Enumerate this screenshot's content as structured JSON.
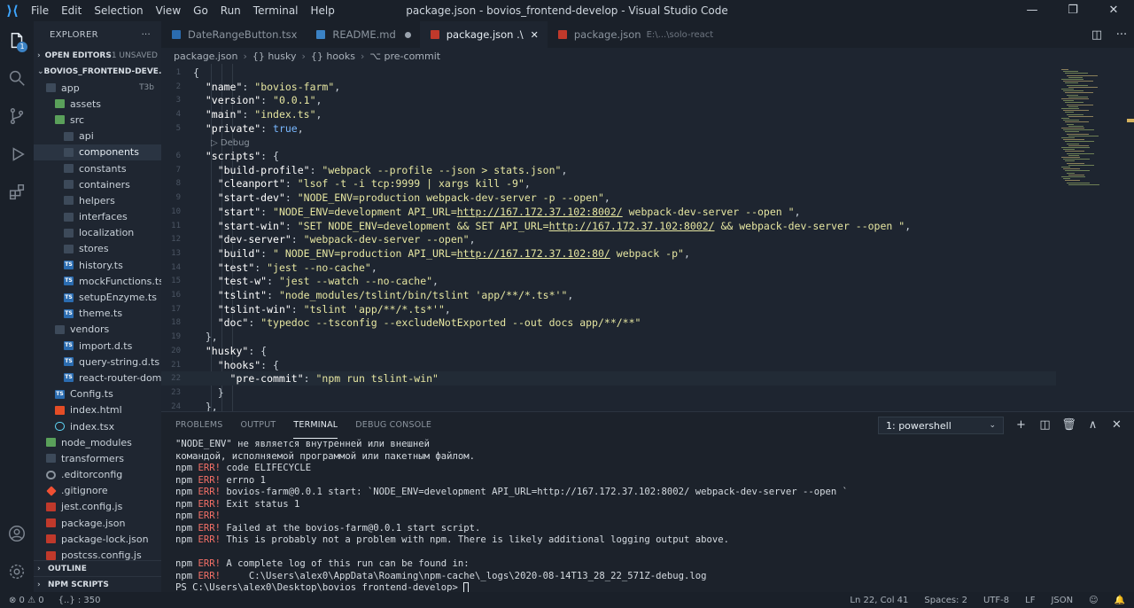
{
  "titlebar": {
    "menu": [
      "File",
      "Edit",
      "Selection",
      "View",
      "Go",
      "Run",
      "Terminal",
      "Help"
    ],
    "title": "package.json - bovios_frontend-develop - Visual Studio Code",
    "minimize": "—",
    "maximize": "❐",
    "close": "✕"
  },
  "activity": {
    "badge": "1"
  },
  "sidebar": {
    "title": "EXPLORER",
    "more": "···",
    "open_editors": "OPEN EDITORS",
    "unsaved": "1 UNSAVED",
    "project": "BOVIOS_FRONTEND-DEVE...",
    "tree": [
      {
        "label": "app",
        "icon": "folder",
        "depth": 0,
        "tag": "T3b"
      },
      {
        "label": "assets",
        "icon": "green",
        "depth": 1
      },
      {
        "label": "src",
        "icon": "green",
        "depth": 1
      },
      {
        "label": "api",
        "icon": "folder",
        "depth": 2
      },
      {
        "label": "components",
        "icon": "folder",
        "depth": 2,
        "selected": true
      },
      {
        "label": "constants",
        "icon": "folder",
        "depth": 2
      },
      {
        "label": "containers",
        "icon": "folder",
        "depth": 2
      },
      {
        "label": "helpers",
        "icon": "folder",
        "depth": 2
      },
      {
        "label": "interfaces",
        "icon": "folder",
        "depth": 2
      },
      {
        "label": "localization",
        "icon": "folder",
        "depth": 2
      },
      {
        "label": "stores",
        "icon": "folder",
        "depth": 2
      },
      {
        "label": "history.ts",
        "icon": "ts",
        "depth": 2
      },
      {
        "label": "mockFunctions.ts",
        "icon": "ts",
        "depth": 2
      },
      {
        "label": "setupEnzyme.ts",
        "icon": "ts",
        "depth": 2
      },
      {
        "label": "theme.ts",
        "icon": "ts",
        "depth": 2
      },
      {
        "label": "vendors",
        "icon": "folder",
        "depth": 1
      },
      {
        "label": "import.d.ts",
        "icon": "ts",
        "depth": 2
      },
      {
        "label": "query-string.d.ts",
        "icon": "ts",
        "depth": 2
      },
      {
        "label": "react-router-dom...",
        "icon": "ts",
        "depth": 2
      },
      {
        "label": "Config.ts",
        "icon": "ts",
        "depth": 1
      },
      {
        "label": "index.html",
        "icon": "html",
        "depth": 1
      },
      {
        "label": "index.tsx",
        "icon": "react",
        "depth": 1
      },
      {
        "label": "node_modules",
        "icon": "green",
        "depth": 0
      },
      {
        "label": "transformers",
        "icon": "folder",
        "depth": 0
      },
      {
        "label": ".editorconfig",
        "icon": "gear",
        "depth": 0
      },
      {
        "label": ".gitignore",
        "icon": "git",
        "depth": 0
      },
      {
        "label": "jest.config.js",
        "icon": "json",
        "depth": 0
      },
      {
        "label": "package.json",
        "icon": "json",
        "depth": 0
      },
      {
        "label": "package-lock.json",
        "icon": "json",
        "depth": 0
      },
      {
        "label": "postcss.config.js",
        "icon": "json",
        "depth": 0
      }
    ],
    "outline": "OUTLINE",
    "npm_scripts": "NPM SCRIPTS"
  },
  "tabs": [
    {
      "label": "DateRangeButton.tsx",
      "icon_color": "#2b6cb0",
      "active": false
    },
    {
      "label": "README.md",
      "icon_color": "#3b82c4",
      "active": false,
      "dirty": true
    },
    {
      "label": "package.json .\\",
      "icon_color": "#c0392b",
      "active": true
    },
    {
      "label": "package.json",
      "icon_color": "#c0392b",
      "active": false,
      "hint": "E:\\...\\solo-react"
    }
  ],
  "tab_actions": {
    "split": "◫",
    "more": "···"
  },
  "breadcrumb": [
    "package.json",
    "{} husky",
    "{} hooks",
    "⌥ pre-commit"
  ],
  "editor": {
    "debug_lens": "▷ Debug",
    "lines": [
      {
        "n": "1",
        "parts": [
          [
            "p",
            "{"
          ]
        ]
      },
      {
        "n": "2",
        "parts": [
          [
            "p",
            "  "
          ],
          [
            "k",
            "\"name\""
          ],
          [
            "p",
            ": "
          ],
          [
            "s",
            "\"bovios-farm\""
          ],
          [
            "p",
            ","
          ]
        ]
      },
      {
        "n": "3",
        "parts": [
          [
            "p",
            "  "
          ],
          [
            "k",
            "\"version\""
          ],
          [
            "p",
            ": "
          ],
          [
            "s",
            "\"0.0.1\""
          ],
          [
            "p",
            ","
          ]
        ]
      },
      {
        "n": "4",
        "parts": [
          [
            "p",
            "  "
          ],
          [
            "k",
            "\"main\""
          ],
          [
            "p",
            ": "
          ],
          [
            "s",
            "\"index.ts\""
          ],
          [
            "p",
            ","
          ]
        ]
      },
      {
        "n": "5",
        "parts": [
          [
            "p",
            "  "
          ],
          [
            "k",
            "\"private\""
          ],
          [
            "p",
            ": "
          ],
          [
            "b",
            "true"
          ],
          [
            "p",
            ","
          ]
        ]
      },
      {
        "n": "",
        "lens": true
      },
      {
        "n": "6",
        "parts": [
          [
            "p",
            "  "
          ],
          [
            "k",
            "\"scripts\""
          ],
          [
            "p",
            ": {"
          ]
        ]
      },
      {
        "n": "7",
        "parts": [
          [
            "p",
            "    "
          ],
          [
            "k",
            "\"build-profile\""
          ],
          [
            "p",
            ": "
          ],
          [
            "s",
            "\"webpack --profile --json > stats.json\""
          ],
          [
            "p",
            ","
          ]
        ]
      },
      {
        "n": "8",
        "parts": [
          [
            "p",
            "    "
          ],
          [
            "k",
            "\"cleanport\""
          ],
          [
            "p",
            ": "
          ],
          [
            "s",
            "\"lsof -t -i tcp:9999 | xargs kill -9\""
          ],
          [
            "p",
            ","
          ]
        ]
      },
      {
        "n": "9",
        "parts": [
          [
            "p",
            "    "
          ],
          [
            "k",
            "\"start-dev\""
          ],
          [
            "p",
            ": "
          ],
          [
            "s",
            "\"NODE_ENV=production webpack-dev-server -p --open\""
          ],
          [
            "p",
            ","
          ]
        ]
      },
      {
        "n": "10",
        "parts": [
          [
            "p",
            "    "
          ],
          [
            "k",
            "\"start\""
          ],
          [
            "p",
            ": "
          ],
          [
            "s",
            "\"NODE_ENV=development API_URL="
          ],
          [
            "su",
            "http://167.172.37.102:8002/"
          ],
          [
            "s",
            " webpack-dev-server --open \""
          ],
          [
            "p",
            ","
          ]
        ]
      },
      {
        "n": "11",
        "parts": [
          [
            "p",
            "    "
          ],
          [
            "k",
            "\"start-win\""
          ],
          [
            "p",
            ": "
          ],
          [
            "s",
            "\"SET NODE_ENV=development && SET API_URL="
          ],
          [
            "su",
            "http://167.172.37.102:8002/"
          ],
          [
            "s",
            " && webpack-dev-server --open \""
          ],
          [
            "p",
            ","
          ]
        ]
      },
      {
        "n": "12",
        "parts": [
          [
            "p",
            "    "
          ],
          [
            "k",
            "\"dev-server\""
          ],
          [
            "p",
            ": "
          ],
          [
            "s",
            "\"webpack-dev-server --open\""
          ],
          [
            "p",
            ","
          ]
        ]
      },
      {
        "n": "13",
        "parts": [
          [
            "p",
            "    "
          ],
          [
            "k",
            "\"build\""
          ],
          [
            "p",
            ": "
          ],
          [
            "s",
            "\" NODE_ENV=production API_URL="
          ],
          [
            "su",
            "http://167.172.37.102:80/"
          ],
          [
            "s",
            " webpack -p\""
          ],
          [
            "p",
            ","
          ]
        ]
      },
      {
        "n": "14",
        "parts": [
          [
            "p",
            "    "
          ],
          [
            "k",
            "\"test\""
          ],
          [
            "p",
            ": "
          ],
          [
            "s",
            "\"jest --no-cache\""
          ],
          [
            "p",
            ","
          ]
        ]
      },
      {
        "n": "15",
        "parts": [
          [
            "p",
            "    "
          ],
          [
            "k",
            "\"test-w\""
          ],
          [
            "p",
            ": "
          ],
          [
            "s",
            "\"jest --watch --no-cache\""
          ],
          [
            "p",
            ","
          ]
        ]
      },
      {
        "n": "16",
        "parts": [
          [
            "p",
            "    "
          ],
          [
            "k",
            "\"tslint\""
          ],
          [
            "p",
            ": "
          ],
          [
            "s",
            "\"node_modules/tslint/bin/tslint 'app/**/*.ts*'\""
          ],
          [
            "p",
            ","
          ]
        ]
      },
      {
        "n": "17",
        "parts": [
          [
            "p",
            "    "
          ],
          [
            "k",
            "\"tslint-win\""
          ],
          [
            "p",
            ": "
          ],
          [
            "s",
            "\"tslint 'app/**/*.ts*'\""
          ],
          [
            "p",
            ","
          ]
        ]
      },
      {
        "n": "18",
        "parts": [
          [
            "p",
            "    "
          ],
          [
            "k",
            "\"doc\""
          ],
          [
            "p",
            ": "
          ],
          [
            "s",
            "\"typedoc --tsconfig --excludeNotExported --out docs app/**/**\""
          ]
        ]
      },
      {
        "n": "19",
        "parts": [
          [
            "p",
            "  },"
          ]
        ]
      },
      {
        "n": "20",
        "parts": [
          [
            "p",
            "  "
          ],
          [
            "k",
            "\"husky\""
          ],
          [
            "p",
            ": {"
          ]
        ]
      },
      {
        "n": "21",
        "parts": [
          [
            "p",
            "    "
          ],
          [
            "k",
            "\"hooks\""
          ],
          [
            "p",
            ": {"
          ]
        ]
      },
      {
        "n": "22",
        "cur": true,
        "parts": [
          [
            "p",
            "      "
          ],
          [
            "k",
            "\"pre-commit\""
          ],
          [
            "p",
            ": "
          ],
          [
            "s",
            "\"npm run tslint-win\""
          ]
        ]
      },
      {
        "n": "23",
        "parts": [
          [
            "p",
            "    }"
          ]
        ]
      },
      {
        "n": "24",
        "parts": [
          [
            "p",
            "  },"
          ]
        ]
      }
    ]
  },
  "panel": {
    "tabs": [
      "PROBLEMS",
      "OUTPUT",
      "TERMINAL",
      "DEBUG CONSOLE"
    ],
    "active_tab": "TERMINAL",
    "terminal_select": "1: powershell",
    "actions": [
      "+",
      "◫",
      "🗑",
      "∧",
      "✕"
    ],
    "terminal_lines": [
      {
        "pre": "",
        "err": "",
        "text": "\"NODE_ENV\" не является внутренней или внешней"
      },
      {
        "pre": "",
        "err": "",
        "text": "командой, исполняемой программой или пакетным файлом."
      },
      {
        "pre": "npm ",
        "err": "ERR!",
        "text": " code ELIFECYCLE"
      },
      {
        "pre": "npm ",
        "err": "ERR!",
        "text": " errno 1"
      },
      {
        "pre": "npm ",
        "err": "ERR!",
        "text": " bovios-farm@0.0.1 start: `NODE_ENV=development API_URL=http://167.172.37.102:8002/ webpack-dev-server --open `"
      },
      {
        "pre": "npm ",
        "err": "ERR!",
        "text": " Exit status 1"
      },
      {
        "pre": "npm ",
        "err": "ERR!",
        "text": ""
      },
      {
        "pre": "npm ",
        "err": "ERR!",
        "text": " Failed at the bovios-farm@0.0.1 start script."
      },
      {
        "pre": "npm ",
        "err": "ERR!",
        "text": " This is probably not a problem with npm. There is likely additional logging output above."
      },
      {
        "pre": "",
        "err": "",
        "text": ""
      },
      {
        "pre": "npm ",
        "err": "ERR!",
        "text": " A complete log of this run can be found in:"
      },
      {
        "pre": "npm ",
        "err": "ERR!",
        "text": "     C:\\Users\\alex0\\AppData\\Roaming\\npm-cache\\_logs\\2020-08-14T13_28_22_571Z-debug.log"
      }
    ],
    "prompt": "PS C:\\Users\\alex0\\Desktop\\bovios_frontend-develop> "
  },
  "statusbar": {
    "left": [
      "⊗ 0  ⚠ 0",
      "{..} : 350"
    ],
    "right": [
      "Ln 22, Col 41",
      "Spaces: 2",
      "UTF-8",
      "LF",
      "JSON",
      "☺",
      "🔔"
    ]
  }
}
